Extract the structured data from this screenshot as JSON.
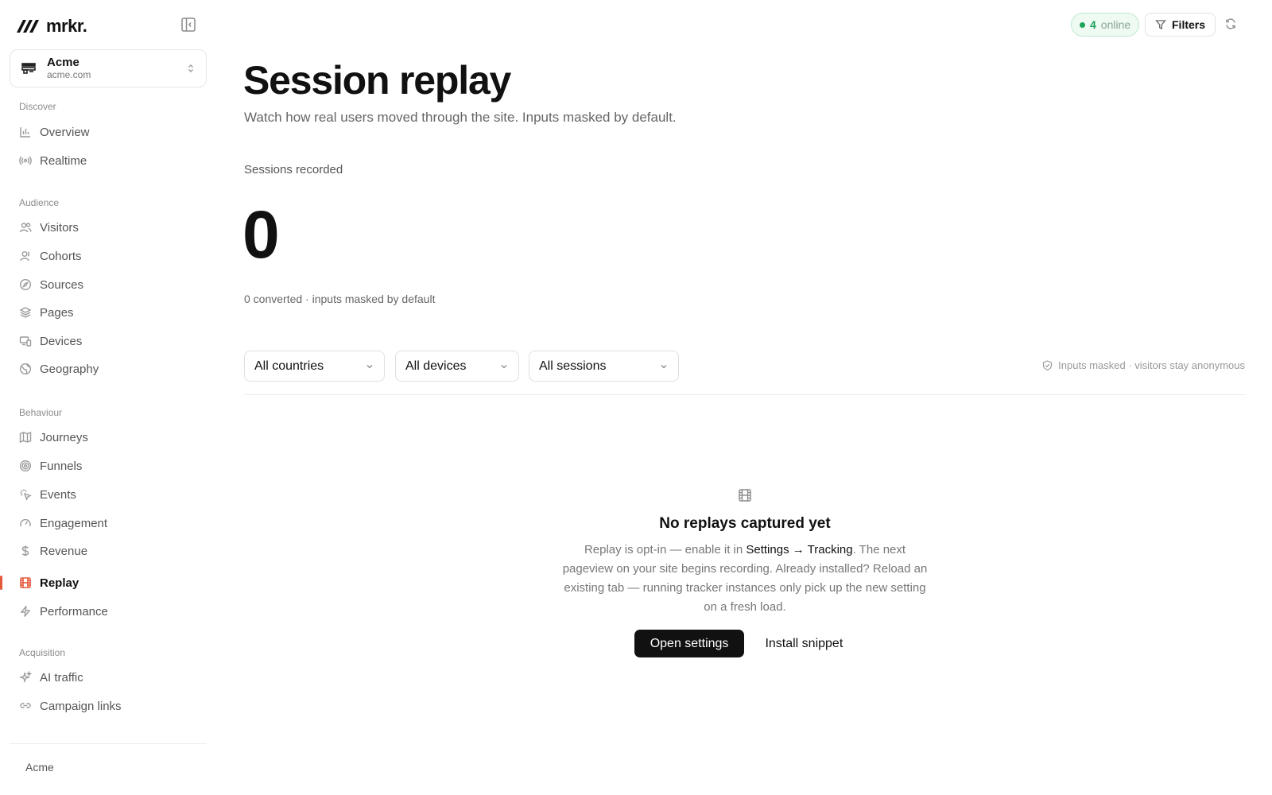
{
  "brand": {
    "name": "mrkr.",
    "accent": "#e4583a"
  },
  "workspace": {
    "name": "Acme",
    "domain": "acme.com"
  },
  "sidebar": {
    "sections": [
      {
        "heading": "Discover",
        "items": [
          {
            "label": "Overview",
            "icon": "bar-chart-icon"
          },
          {
            "label": "Realtime",
            "icon": "broadcast-icon"
          }
        ]
      },
      {
        "heading": "Audience",
        "items": [
          {
            "label": "Visitors",
            "icon": "users-icon"
          },
          {
            "label": "Cohorts",
            "icon": "user-group-icon"
          },
          {
            "label": "Sources",
            "icon": "compass-icon"
          },
          {
            "label": "Pages",
            "icon": "layers-icon"
          },
          {
            "label": "Devices",
            "icon": "devices-icon"
          },
          {
            "label": "Geography",
            "icon": "globe-icon"
          }
        ]
      },
      {
        "heading": "Behaviour",
        "items": [
          {
            "label": "Journeys",
            "icon": "map-icon"
          },
          {
            "label": "Funnels",
            "icon": "target-icon"
          },
          {
            "label": "Events",
            "icon": "cursor-click-icon"
          },
          {
            "label": "Engagement",
            "icon": "gauge-icon"
          },
          {
            "label": "Revenue",
            "icon": "dollar-icon"
          },
          {
            "label": "Replay",
            "icon": "film-icon",
            "active": true
          },
          {
            "label": "Performance",
            "icon": "bolt-icon"
          }
        ]
      },
      {
        "heading": "Acquisition",
        "items": [
          {
            "label": "AI traffic",
            "icon": "sparkles-icon"
          },
          {
            "label": "Campaign links",
            "icon": "link-icon"
          }
        ]
      }
    ],
    "footer_workspace": "Acme"
  },
  "topbar": {
    "online_count": "4",
    "online_label": "online",
    "filters_label": "Filters"
  },
  "main": {
    "title": "Session replay",
    "subtitle": "Watch how real users moved through the site. Inputs masked by default.",
    "metric_label": "Sessions recorded",
    "metric_value": "0",
    "metric_sub": "0 converted · inputs masked by default",
    "filters": {
      "country": "All countries",
      "device": "All devices",
      "session": "All sessions"
    },
    "masked_note": "Inputs masked · visitors stay anonymous"
  },
  "empty_state": {
    "title": "No replays captured yet",
    "body_before": "Replay is opt-in — enable it in ",
    "body_link": "Settings → Tracking",
    "body_after": ". The next pageview on your site begins recording. Already installed? Reload an existing tab — running tracker instances only pick up the new setting on a fresh load.",
    "primary_action": "Open settings",
    "secondary_action": "Install snippet"
  }
}
